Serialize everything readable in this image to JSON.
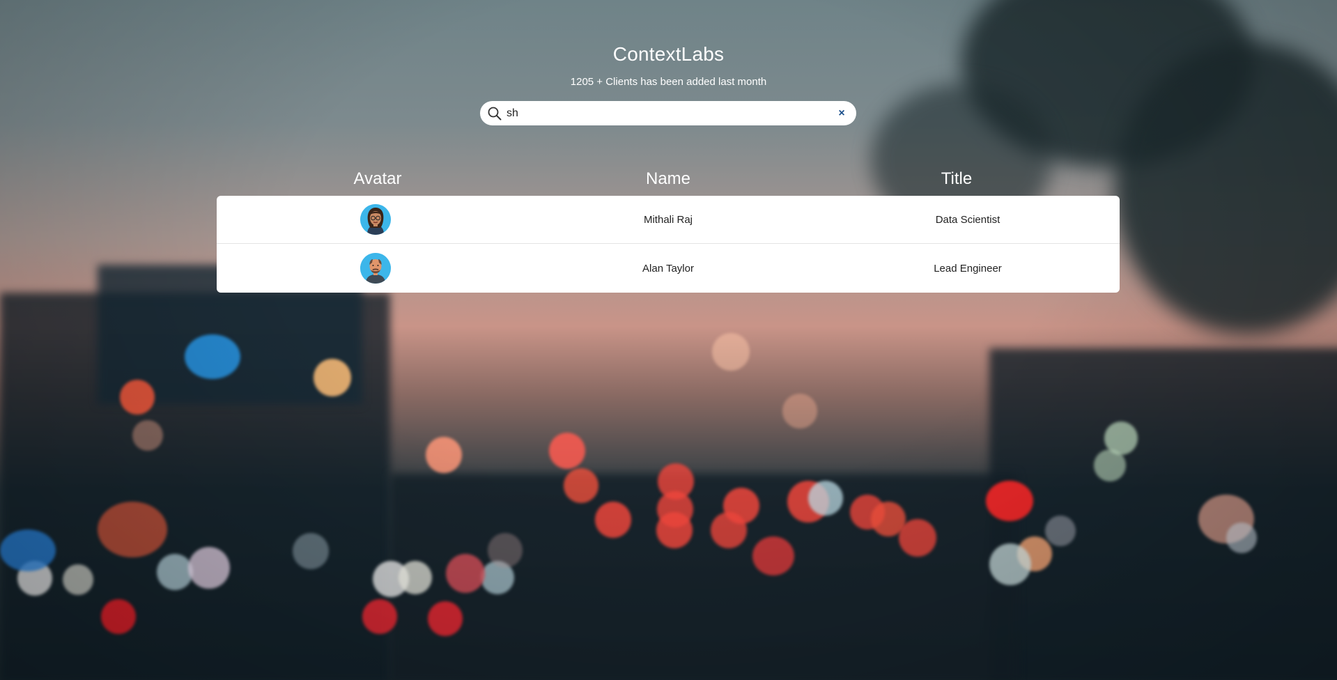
{
  "app": {
    "title": "ContextLabs",
    "subtitle": "1205 + Clients has been added last month"
  },
  "search": {
    "value": "sh",
    "icon": "search-icon",
    "clear_icon": "close-icon",
    "clear_symbol": "×"
  },
  "table": {
    "headers": {
      "avatar": "Avatar",
      "name": "Name",
      "title": "Title"
    },
    "rows": [
      {
        "avatar": "female-avatar-icon",
        "name": "Mithali Raj",
        "title": "Data Scientist"
      },
      {
        "avatar": "male-avatar-icon",
        "name": "Alan Taylor",
        "title": "Lead Engineer"
      }
    ]
  },
  "colors": {
    "accent": "#1a4f8b",
    "avatar_bg": "#3cb6ea",
    "text_light": "#ffffff"
  }
}
